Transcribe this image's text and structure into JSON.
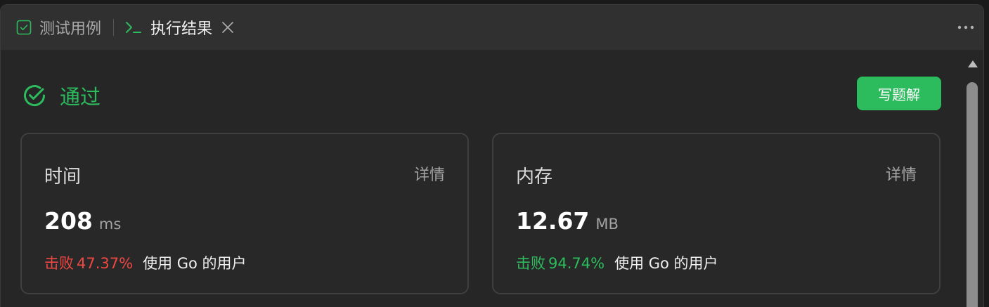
{
  "tabs": {
    "test_cases": {
      "label": "测试用例",
      "icon": "checkbox-icon"
    },
    "result": {
      "label": "执行结果",
      "icon": "terminal-icon",
      "close_icon": "close-icon"
    },
    "more_icon": "more-dots-icon"
  },
  "status": {
    "text": "通过",
    "icon": "check-circle-icon"
  },
  "solution_button": {
    "label": "写题解"
  },
  "cards": [
    {
      "title": "时间",
      "detail_link": "详情",
      "value": "208",
      "unit": "ms",
      "beat_label": "击败",
      "beat_percent": "47.37%",
      "beat_suffix": "使用 Go 的用户",
      "beat_color": "#ef4743"
    },
    {
      "title": "内存",
      "detail_link": "详情",
      "value": "12.67",
      "unit": "MB",
      "beat_label": "击败",
      "beat_percent": "94.74%",
      "beat_suffix": "使用 Go 的用户",
      "beat_color": "#2cbb5d"
    }
  ],
  "colors": {
    "accent": "#2cbb5d",
    "danger": "#ef4743",
    "background": "#262626",
    "tabbar": "#303030"
  }
}
